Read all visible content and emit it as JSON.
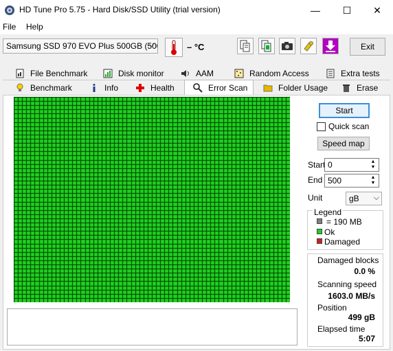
{
  "window": {
    "title": "HD Tune Pro 5.75 - Hard Disk/SSD Utility (trial version)",
    "min_glyph": "—",
    "max_glyph": "☐",
    "close_glyph": "✕"
  },
  "menu": {
    "file": "File",
    "help": "Help"
  },
  "toolbar": {
    "drive": "Samsung SSD 970 EVO Plus 500GB (500",
    "temperature": "– °C",
    "exit_label": "Exit",
    "icons": [
      "copy-info-icon",
      "copy-all-icon",
      "screenshot-icon",
      "options-icon",
      "save-icon"
    ]
  },
  "tabs": {
    "row1": [
      "File Benchmark",
      "Disk monitor",
      "AAM",
      "Random Access",
      "Extra tests"
    ],
    "row2": [
      "Benchmark",
      "Info",
      "Health",
      "Error Scan",
      "Folder Usage",
      "Erase"
    ],
    "active": "Error Scan"
  },
  "scan": {
    "start_label": "Start",
    "quick_scan_label": "Quick scan",
    "quick_scan_checked": false,
    "speed_map_label": "Speed map",
    "start_field_label": "Start",
    "start_value": "0",
    "end_field_label": "End",
    "end_value": "500",
    "unit_label": "Unit",
    "unit_value": "gB",
    "grid_cols": 66,
    "grid_rows": 49,
    "block_status": "ok"
  },
  "legend": {
    "title": "Legend",
    "block_size": "= 190 MB",
    "ok": "Ok",
    "damaged": "Damaged"
  },
  "stats": {
    "damaged_blocks_label": "Damaged blocks",
    "damaged_blocks_value": "0.0 %",
    "scanning_speed_label": "Scanning speed",
    "scanning_speed_value": "1603.0 MB/s",
    "position_label": "Position",
    "position_value": "499 gB",
    "elapsed_label": "Elapsed time",
    "elapsed_value": "5:07"
  },
  "colors": {
    "ok": "#1fd11f",
    "damaged": "#d11f1f",
    "block_size": "#808080",
    "start_border": "#3b8fd9"
  }
}
